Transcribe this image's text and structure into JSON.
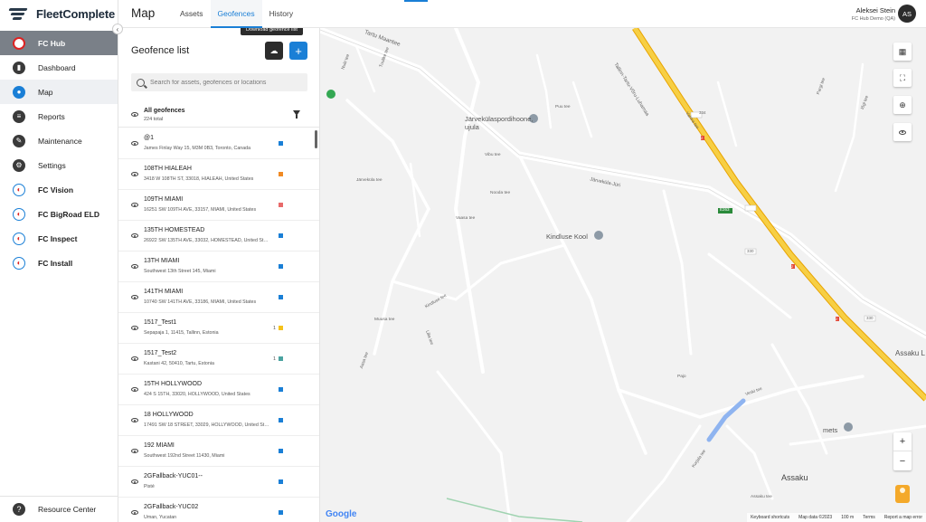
{
  "sidebar": {
    "logo_text": "FleetComplete",
    "hub_label": "FC Hub",
    "items": [
      {
        "label": "Dashboard",
        "icon": "dashboard-icon"
      },
      {
        "label": "Map",
        "icon": "map-pin-icon"
      },
      {
        "label": "Reports",
        "icon": "reports-icon"
      },
      {
        "label": "Maintenance",
        "icon": "wrench-icon"
      },
      {
        "label": "Settings",
        "icon": "gear-icon"
      }
    ],
    "brands": [
      {
        "label": "FC Vision"
      },
      {
        "label": "FC BigRoad ELD"
      },
      {
        "label": "FC Inspect"
      },
      {
        "label": "FC Install"
      }
    ],
    "footer_label": "Resource Center"
  },
  "header": {
    "title": "Map",
    "tabs": [
      {
        "label": "Assets"
      },
      {
        "label": "Geofences"
      },
      {
        "label": "History"
      }
    ],
    "user_name": "Aleksei Stein",
    "user_company": "FC Hub Demo (QA)",
    "avatar_initials": "AS"
  },
  "panel": {
    "title": "Geofence list",
    "tooltip": "Download geofence list",
    "add_label": "+",
    "search_placeholder": "Search for assets, geofences or locations",
    "all_title": "All geofences",
    "all_count": "224 total",
    "items": [
      {
        "name": "@1",
        "address": "James Finlay Way 15, M3M 0B3, Toronto, Canada",
        "count": "",
        "color": "#1a7fd6"
      },
      {
        "name": "108TH HIALEAH",
        "address": "3418 W 108TH ST, 33018, HIALEAH, United States",
        "count": "",
        "color": "#f08a24"
      },
      {
        "name": "109TH MIAMI",
        "address": "16251 SW 109TH AVE, 33157, MIAMI, United States",
        "count": "",
        "color": "#e86a6a"
      },
      {
        "name": "135TH HOMESTEAD",
        "address": "26922 SW 135TH AVE, 33032, HOMESTEAD, United States",
        "count": "",
        "color": "#1a7fd6"
      },
      {
        "name": "13TH MIAMI",
        "address": "Southwest 13th Street 145, Miami",
        "count": "",
        "color": "#1a7fd6"
      },
      {
        "name": "141TH MIAMI",
        "address": "10740 SW 141TH AVE, 33186, MIAMI, United States",
        "count": "",
        "color": "#1a7fd6"
      },
      {
        "name": "1517_Test1",
        "address": "Sepapaja 1, 11415, Tallinn, Estonia",
        "count": "1",
        "color": "#f5c21b"
      },
      {
        "name": "1517_Test2",
        "address": "Kastani 42, 50410, Tartu, Estonia",
        "count": "1",
        "color": "#4aa3a0"
      },
      {
        "name": "15TH HOLLYWOOD",
        "address": "424 S 15TH, 33020, HOLLYWOOD, United States",
        "count": "",
        "color": "#1a7fd6"
      },
      {
        "name": "18 HOLLYWOOD",
        "address": "17491 SW 18 STREET, 33029, HOLLYWOOD, United States",
        "count": "",
        "color": "#1a7fd6"
      },
      {
        "name": "192 MIAMI",
        "address": "Southwest 192nd Street 11430, Miami",
        "count": "",
        "color": "#1a7fd6"
      },
      {
        "name": "2GFallback-YUC01--",
        "address": "Pisté",
        "count": "",
        "color": "#1a7fd6"
      },
      {
        "name": "2GFallback-YUC02",
        "address": "Uman, Yucatan",
        "count": "",
        "color": "#1a7fd6"
      }
    ]
  },
  "map": {
    "pois": [
      {
        "label": "Järvekülaspordihoone, ujula"
      },
      {
        "label": "Kindluse Kool"
      },
      {
        "label": "mets"
      },
      {
        "label": "Assaku"
      },
      {
        "label": "Assaku L"
      }
    ],
    "streets": [
      "Tartu Maantee",
      "Tallinn-Tartu-Võru-Luhamaa",
      "Järveküla-Jüri",
      "Järveküla tee",
      "Vibu tee",
      "Kindluse tee",
      "Veski tee",
      "Assaku tee",
      "Kurjala tee",
      "Pajo",
      "Vaasa tee",
      "Nooda tee",
      "Lilla tee",
      "Aasa tee",
      "Tuulike tee",
      "Nuki tee",
      "Muusa tee",
      "Pargi tee",
      "Iõgi tee",
      "Vahtra tee",
      "Puu tee"
    ],
    "road_numbers": [
      "334",
      "E263",
      "330",
      "330",
      "2",
      "2",
      "2"
    ],
    "footer": [
      "Keyboard shortcuts",
      "Map data ©2023",
      "100 m",
      "Terms",
      "Report a map error"
    ],
    "google_logo": "Google",
    "zoom_in": "+",
    "zoom_out": "−"
  }
}
